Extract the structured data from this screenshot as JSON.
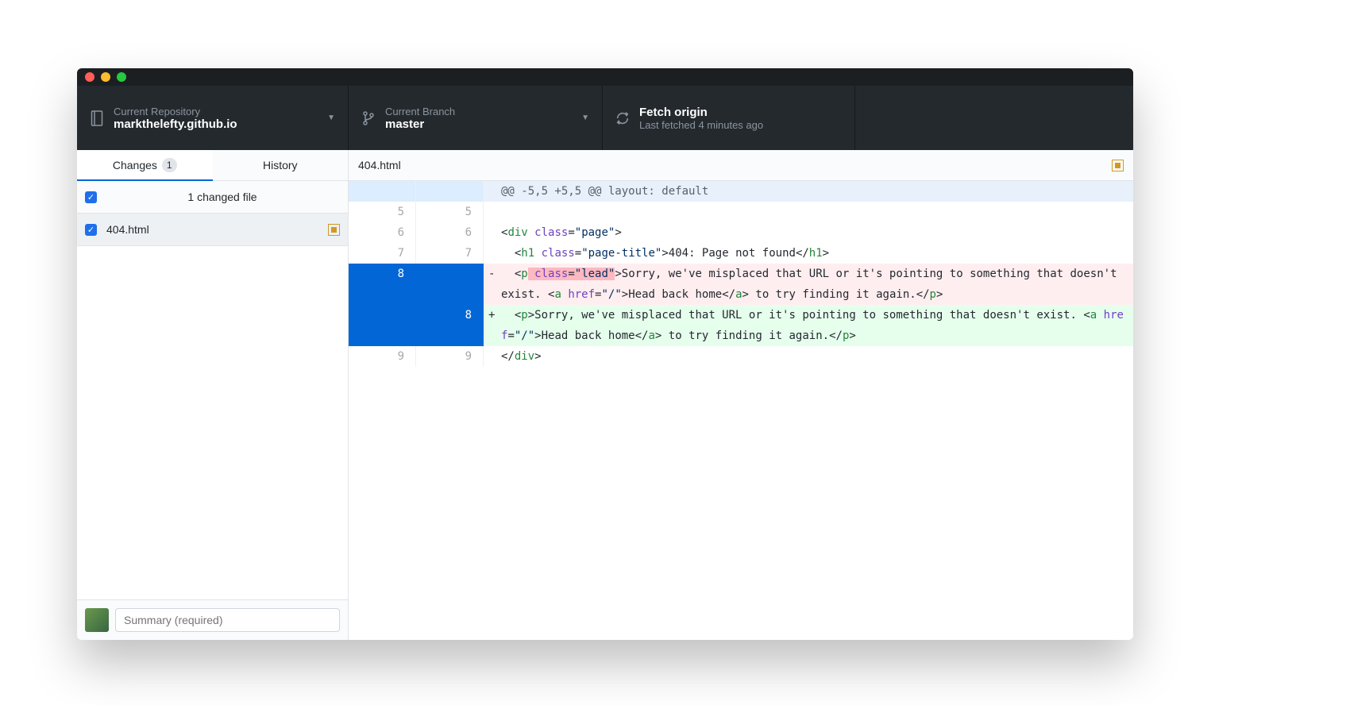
{
  "toolbar": {
    "repo_label": "Current Repository",
    "repo_value": "markthelefty.github.io",
    "branch_label": "Current Branch",
    "branch_value": "master",
    "fetch_label": "Fetch origin",
    "fetch_value": "Last fetched 4 minutes ago"
  },
  "tabs": {
    "changes_label": "Changes",
    "changes_count": "1",
    "history_label": "History"
  },
  "changes": {
    "summary": "1 changed file",
    "file": "404.html"
  },
  "diff": {
    "filename": "404.html",
    "hunk_header": "@@ -5,5 +5,5 @@ layout: default",
    "line5": "",
    "line6": "<div class=\"page\">",
    "line7": "  <h1 class=\"page-title\">404: Page not found</h1>",
    "del8": "  <p class=\"lead\">Sorry, we've misplaced that URL or it's pointing to something that doesn't exist. <a href=\"/\">Head back home</a> to try finding it again.</p>",
    "add8": "  <p>Sorry, we've misplaced that URL or it's pointing to something that doesn't exist. <a href=\"/\">Head back home</a> to try finding it again.</p>",
    "line9": "</div>",
    "ln": {
      "5": "5",
      "6": "6",
      "7": "7",
      "8": "8",
      "9": "9"
    }
  },
  "commit": {
    "summary_placeholder": "Summary (required)"
  }
}
